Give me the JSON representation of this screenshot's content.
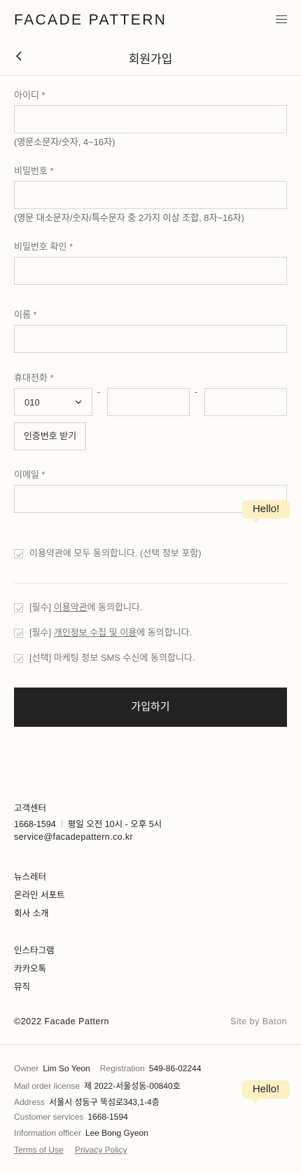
{
  "header": {
    "logo": "FACADE PATTERN",
    "menu_icon": "hamburger-menu-icon"
  },
  "titlebar": {
    "title": "회원가입",
    "back_icon": "chevron-left-icon"
  },
  "form": {
    "id_label": "아이디 *",
    "id_value": "",
    "id_hint": "(영문소문자/숫자, 4~16자)",
    "password_label": "비밀번호 *",
    "password_value": "",
    "password_hint": "(영문 대소문자/숫자/특수문자 중 2가지 이상 조합, 8자~16자)",
    "password_confirm_label": "비밀번호 확인 *",
    "password_confirm_value": "",
    "name_label": "이름 *",
    "name_value": "",
    "phone_label": "휴대전화 *",
    "phone_prefix_selected": "010",
    "phone_dash": "-",
    "phone_middle": "",
    "phone_last": "",
    "verify_button": "인증번호 받기",
    "email_label": "이메일 *",
    "email_value": ""
  },
  "agreements": {
    "all": "이용약관에 모두 동의합니다. (선택 정보 포함)",
    "terms_prefix": "[필수] ",
    "terms_link": "이용약관",
    "terms_suffix": "에 동의합니다.",
    "privacy_prefix": "[필수] ",
    "privacy_link": "개인정보 수집 및 이용",
    "privacy_suffix": "에 동의합니다.",
    "marketing": "[선택] 마케팅 정보 SMS 수신에 동의합니다.",
    "check_icon": "checkmark-icon"
  },
  "submit_label": "가입하기",
  "hello_bubble": "Hello!",
  "footer": {
    "cs_title": "고객센터",
    "cs_phone": "1668-1594",
    "cs_hours": "평일 오전 10시 - 오후 5시",
    "cs_email": "service@facadepattern.co.kr",
    "links_1": [
      "뉴스레터",
      "온라인 서포트",
      "회사 소개"
    ],
    "links_2": [
      "인스타그램",
      "카카오톡",
      "뮤직"
    ],
    "copyright": "©2022 Facade Pattern",
    "site_by": "Site by Baton",
    "owner_key": "Owner",
    "owner_val": "Lim So Yeon",
    "registration_key": "Registration",
    "registration_val": "549-86-02244",
    "mail_order_key": "Mail order license",
    "mail_order_val": "제 2022-서울성동-00840호",
    "address_key": "Address",
    "address_val": "서울시 성동구 뚝섬로343,1-4층",
    "customer_key": "Customer services",
    "customer_val": "1668-1594",
    "info_officer_key": "Information officer",
    "info_officer_val": "Lee Bong Gyeon",
    "terms_of_use": "Terms of Use",
    "privacy_policy": "Privacy Policy"
  }
}
